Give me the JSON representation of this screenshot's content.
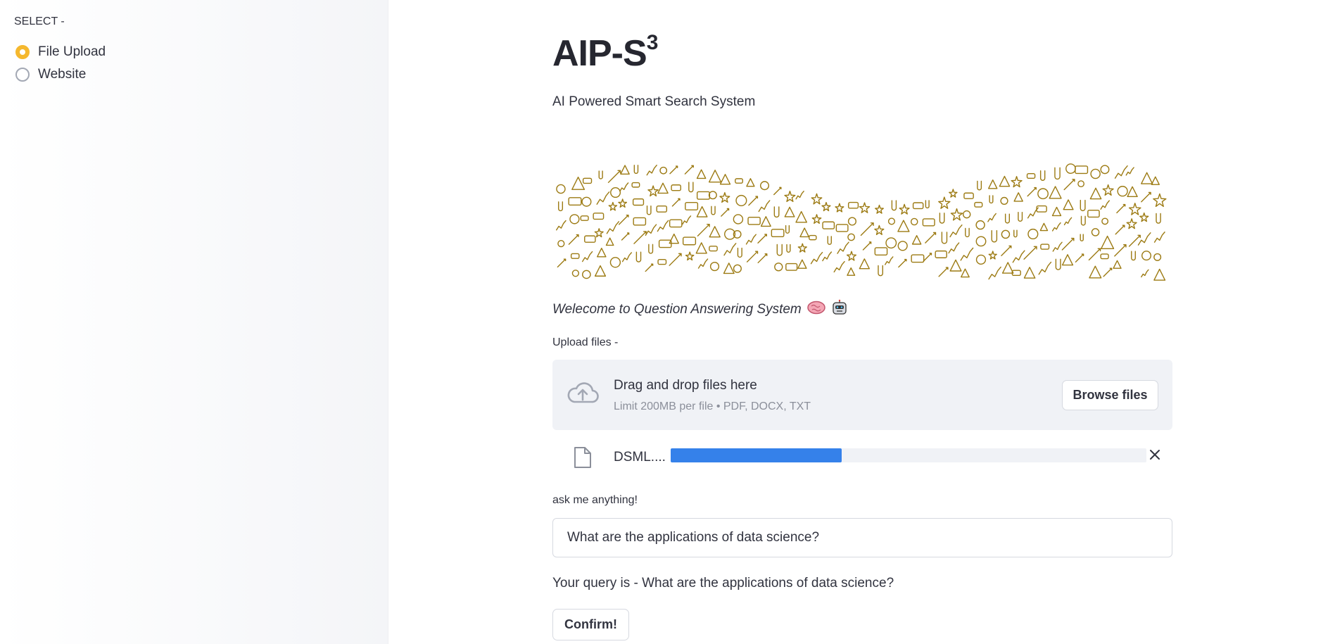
{
  "colors": {
    "accent": "#f5b82e",
    "progress": "#3581ea",
    "doodle": "#9c7a12"
  },
  "sidebar": {
    "label": "SELECT -",
    "options": [
      {
        "label": "File Upload",
        "selected": true
      },
      {
        "label": "Website",
        "selected": false
      }
    ]
  },
  "main": {
    "title": "AIP-S",
    "title_superscript": "3",
    "subtitle": "AI Powered Smart Search System",
    "banner_icon": "education-doodle-banner",
    "welcome": "Welecome to Question Answering System",
    "welcome_icons": [
      "brain-icon",
      "robot-face-icon"
    ]
  },
  "uploader": {
    "label": "Upload files -",
    "drop_title": "Drag and drop files here",
    "drop_subtitle": "Limit 200MB per file • PDF, DOCX, TXT",
    "browse_label": "Browse files",
    "file": {
      "name": "DSML....",
      "progress": 0.36
    }
  },
  "query": {
    "label": "ask me anything!",
    "value": "What are the applications of data science?",
    "echo": "Your query is - What are the applications of data science?",
    "confirm_label": "Confirm!"
  }
}
